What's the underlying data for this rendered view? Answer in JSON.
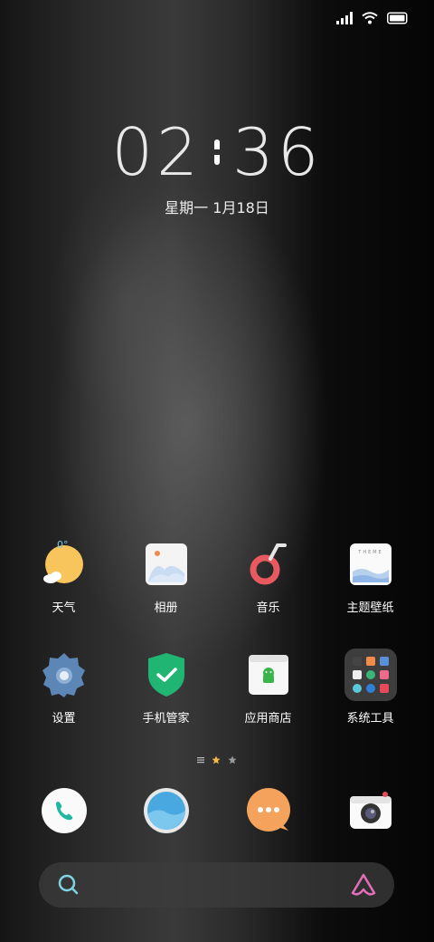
{
  "status_bar": {
    "icons": [
      "signal-icon",
      "wifi-icon",
      "battery-icon"
    ]
  },
  "lock_clock": {
    "hours": "02",
    "minutes": "36",
    "date": "星期一 1月18日"
  },
  "apps_row1": [
    {
      "label": "天气",
      "icon": "weather-icon"
    },
    {
      "label": "相册",
      "icon": "gallery-icon"
    },
    {
      "label": "音乐",
      "icon": "music-icon"
    },
    {
      "label": "主题壁纸",
      "icon": "theme-icon"
    }
  ],
  "apps_row2": [
    {
      "label": "设置",
      "icon": "settings-icon"
    },
    {
      "label": "手机管家",
      "icon": "phone-manager-icon"
    },
    {
      "label": "应用商店",
      "icon": "app-store-icon"
    },
    {
      "label": "系统工具",
      "icon": "system-tools-folder-icon"
    }
  ],
  "theme_icon_text": "THEME",
  "dock": [
    {
      "icon": "phone-icon"
    },
    {
      "icon": "browser-icon"
    },
    {
      "icon": "messages-icon"
    },
    {
      "icon": "camera-icon"
    }
  ],
  "search": {
    "icon": "search-icon",
    "assistant_icon": "assistant-icon"
  },
  "colors": {
    "accent_orange": "#f5a35c",
    "weather_yellow": "#f8c55d",
    "music_red": "#e85a5f",
    "manager_green": "#21b573",
    "settings_blue": "#5b86b5"
  }
}
